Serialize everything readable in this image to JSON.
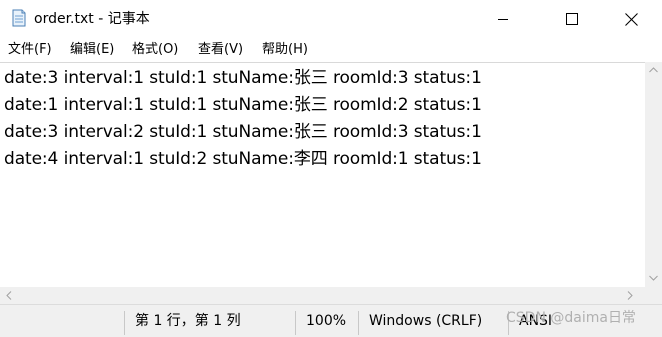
{
  "window": {
    "title": "order.txt - 记事本",
    "file_icon": "notepad-file-icon",
    "controls": [
      "minimize-icon",
      "maximize-icon",
      "close-icon"
    ]
  },
  "menu": {
    "items": [
      {
        "label": "文件(F)"
      },
      {
        "label": "编辑(E)"
      },
      {
        "label": "格式(O)"
      },
      {
        "label": "查看(V)"
      },
      {
        "label": "帮助(H)"
      }
    ]
  },
  "editor": {
    "lines": [
      "date:3 interval:1 stuId:1 stuName:张三 roomId:3 status:1",
      "date:1 interval:1 stuId:1 stuName:张三 roomId:2 status:1",
      "date:3 interval:2 stuId:1 stuName:张三 roomId:3 status:1",
      "date:4 interval:1 stuId:2 stuName:李四 roomId:1 status:1"
    ]
  },
  "status": {
    "position": "第 1 行，第 1 列",
    "zoom": "100%",
    "line_ending": "Windows (CRLF)",
    "encoding": "ANSI"
  },
  "watermark": "CSDN @daima日常"
}
